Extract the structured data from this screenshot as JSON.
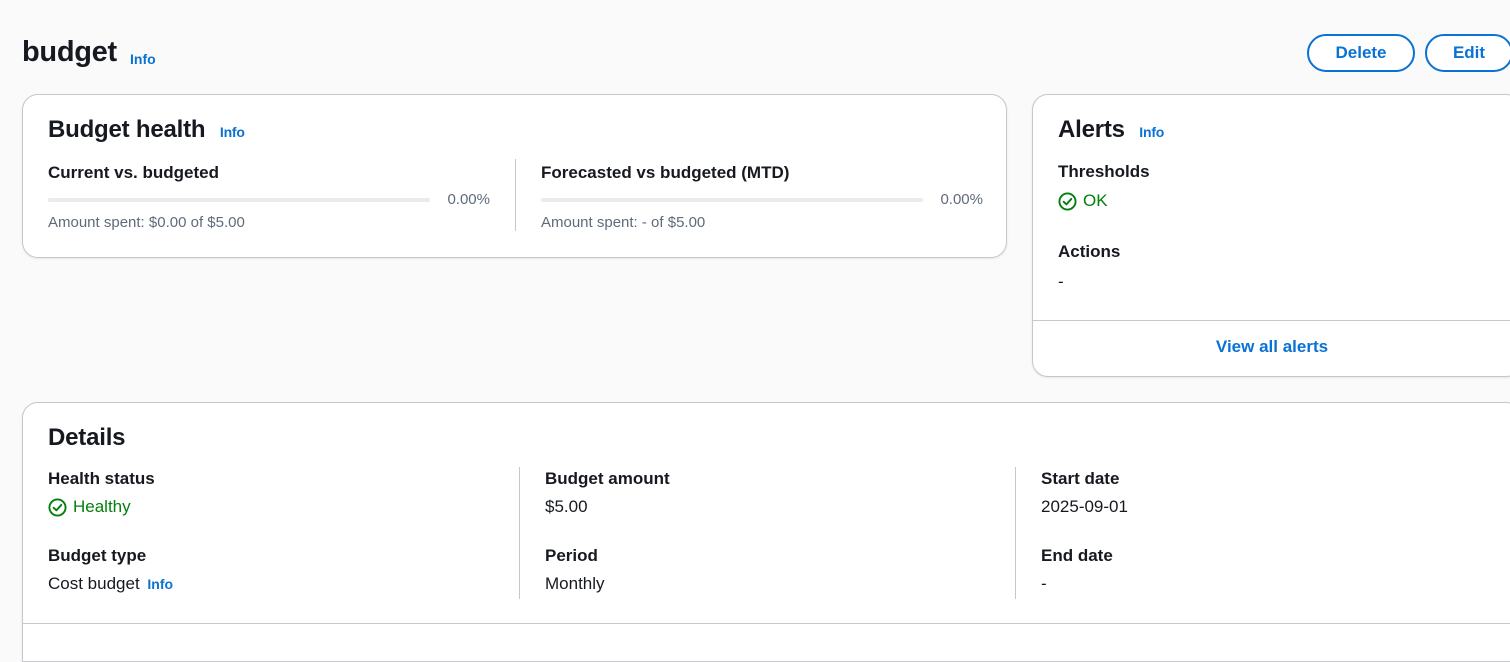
{
  "header": {
    "title": "budget",
    "info_label": "Info",
    "delete_label": "Delete",
    "edit_label": "Edit"
  },
  "budget_health": {
    "title": "Budget health",
    "info_label": "Info",
    "current": {
      "label": "Current vs. budgeted",
      "percent": "0.00%",
      "progress_fraction": 0,
      "amount_text": "Amount spent: $0.00 of $5.00"
    },
    "forecasted": {
      "label": "Forecasted vs budgeted (MTD)",
      "percent": "0.00%",
      "progress_fraction": 0,
      "amount_text": "Amount spent: - of $5.00"
    }
  },
  "alerts": {
    "title": "Alerts",
    "info_label": "Info",
    "thresholds_label": "Thresholds",
    "thresholds_status": "OK",
    "actions_label": "Actions",
    "actions_value": "-",
    "view_all_label": "View all alerts"
  },
  "details": {
    "title": "Details",
    "health_status_label": "Health status",
    "health_status_value": "Healthy",
    "budget_type_label": "Budget type",
    "budget_type_value": "Cost budget",
    "budget_type_info": "Info",
    "budget_amount_label": "Budget amount",
    "budget_amount_value": "$5.00",
    "period_label": "Period",
    "period_value": "Monthly",
    "start_date_label": "Start date",
    "start_date_value": "2025-09-01",
    "end_date_label": "End date",
    "end_date_value": "-"
  },
  "colors": {
    "link": "#0972d3",
    "success": "#037f0c",
    "border": "#c6c6cd",
    "background": "#fafafa"
  },
  "icons": {
    "status_ok": "check-circle-icon"
  }
}
